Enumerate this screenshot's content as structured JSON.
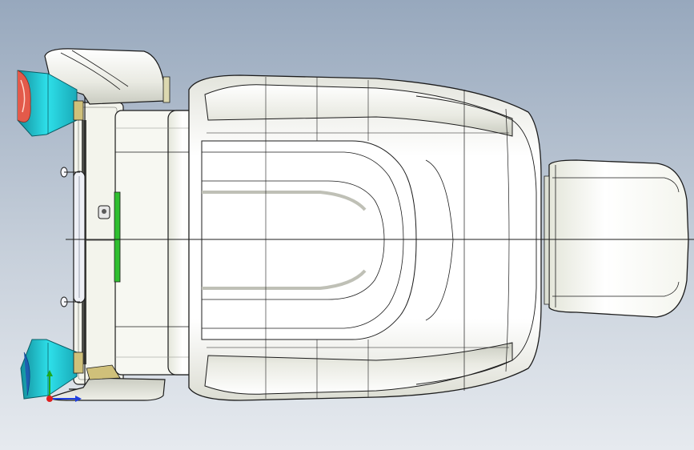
{
  "viewport": {
    "background_top": "#97a8bd",
    "background_bottom": "#e6eaef"
  },
  "model": {
    "body_color": "#fdfdf8",
    "shadow_color": "#c9cbc0",
    "edge_color": "#1c1c1c",
    "accent_cyan": "#23d3e0",
    "accent_red": "#e35a4a",
    "accent_green": "#2fbf2f",
    "accent_tan": "#cfc07a"
  },
  "triad": {
    "x_color": "#1f3fe0",
    "y_color": "#1ea81e",
    "z_color": "#e01f1f"
  }
}
